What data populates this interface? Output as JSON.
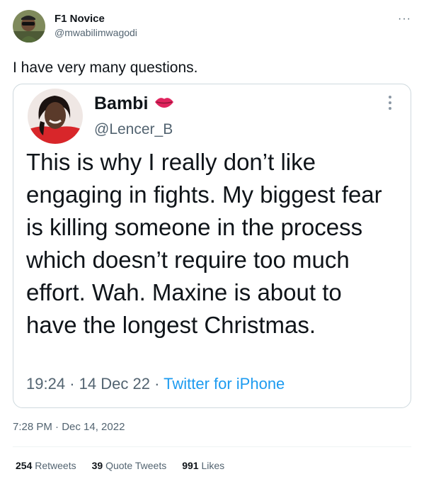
{
  "author": {
    "name": "F1 Novice",
    "handle": "@mwabilimwagodi"
  },
  "more_glyph": "···",
  "tweet_text": "I have very many questions.",
  "quoted": {
    "name": "Bambi",
    "name_emoji_icon": "lips-icon",
    "handle": "@Lencer_B",
    "text": "This is why I really don’t like engaging in fights. My biggest fear is killing someone in the process which doesn’t require too much effort. Wah. Maxine is about to have the longest Christmas.",
    "time": "19:24",
    "date": "14 Dec 22",
    "separator": "·",
    "source": "Twitter for iPhone"
  },
  "timestamp": "7:28 PM · Dec 14, 2022",
  "stats": {
    "retweets_count": "254",
    "retweets_label": "Retweets",
    "quotes_count": "39",
    "quotes_label": "Quote Tweets",
    "likes_count": "991",
    "likes_label": "Likes"
  },
  "colors": {
    "link": "#1d9bf0",
    "secondary_text": "#536471",
    "lips": "#e0245e"
  }
}
